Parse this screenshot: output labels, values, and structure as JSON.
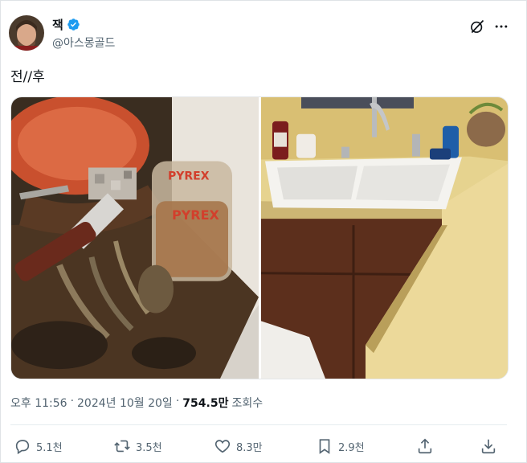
{
  "author": {
    "display_name": "잭",
    "handle": "@아스몽골드",
    "verified": true
  },
  "tweet": {
    "text": "전//후"
  },
  "media": {
    "count": 2,
    "items": [
      {
        "label": "before-photo"
      },
      {
        "label": "after-photo"
      }
    ]
  },
  "meta": {
    "time": "오후 11:56",
    "separator": "·",
    "date": "2024년 10월 20일",
    "separator2": "·",
    "views_count": "754.5만",
    "views_label": "조회수"
  },
  "actions": {
    "reply_count": "5.1천",
    "retweet_count": "3.5천",
    "like_count": "8.3만",
    "bookmark_count": "2.9천"
  },
  "colors": {
    "verified_blue": "#1d9bf0",
    "secondary_text": "#536471",
    "primary_text": "#0f1419"
  },
  "icons": [
    "grok-icon",
    "more-icon",
    "reply-icon",
    "retweet-icon",
    "like-icon",
    "bookmark-icon",
    "share-icon",
    "download-icon"
  ]
}
